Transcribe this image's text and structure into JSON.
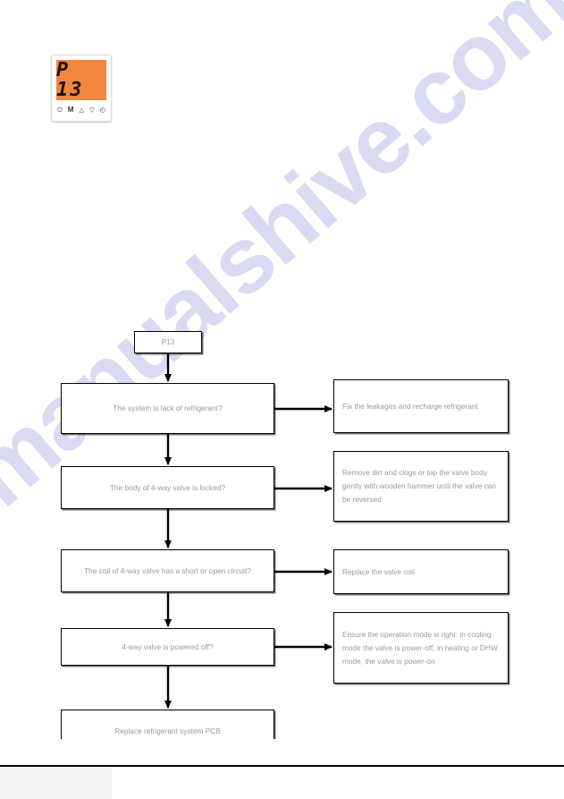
{
  "page": {
    "watermark": "manualshive.com",
    "background_color": "#ffffff"
  },
  "lcd_module": {
    "name": "controller-display",
    "screen_color": "#f2853f",
    "digit_color": "#20150e",
    "code": "P 13",
    "icons": [
      {
        "name": "power-icon",
        "glyph": "⏻"
      },
      {
        "name": "mode-m-icon",
        "glyph": "M"
      },
      {
        "name": "up-triangle-icon",
        "glyph": "△"
      },
      {
        "name": "down-triangle-icon",
        "glyph": "▽"
      },
      {
        "name": "clock-icon",
        "glyph": "◴"
      }
    ]
  },
  "flowchart": {
    "start": {
      "label": "P13"
    },
    "questions": [
      {
        "id": "q1",
        "label": "The system is lack of refrigerant?"
      },
      {
        "id": "q2",
        "label": "The body of 4-way valve is locked?"
      },
      {
        "id": "q3",
        "label": "The coil of 4-way valve has a short or open circuit?"
      },
      {
        "id": "q4",
        "label": "4-way valve is powered off?"
      },
      {
        "id": "q5",
        "label": "Replace refrigerant system PCB"
      }
    ],
    "actions": [
      {
        "id": "a1",
        "label": "Fix the leakages and recharge refrigerant"
      },
      {
        "id": "a2",
        "label": "Remove dirt and clogs or tap the valve body gently with wooden hammer until the valve can be reversed"
      },
      {
        "id": "a3",
        "label": "Replace the valve coil"
      },
      {
        "id": "a4",
        "label": "Ensure the operation mode is right: in cooling mode the valve is power-off, in heating or DHW mode, the valve is power-on"
      }
    ]
  },
  "footer": {
    "rule_color": "#000000",
    "block_color": "#f4f4f4"
  }
}
